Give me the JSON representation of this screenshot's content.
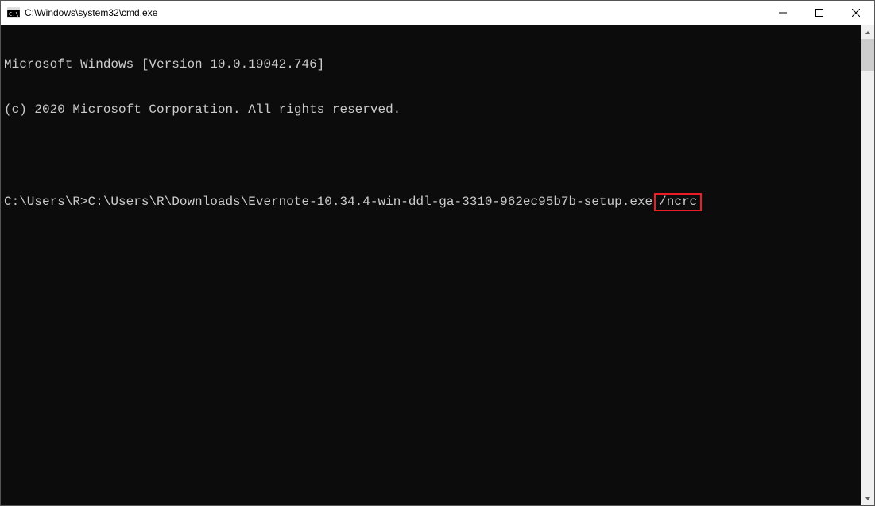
{
  "titlebar": {
    "title": "C:\\Windows\\system32\\cmd.exe"
  },
  "terminal": {
    "line1": "Microsoft Windows [Version 10.0.19042.746]",
    "line2": "(c) 2020 Microsoft Corporation. All rights reserved.",
    "line3_prompt": "C:\\Users\\R>",
    "line3_command": "C:\\Users\\R\\Downloads\\Evernote-10.34.4-win-ddl-ga-3310-962ec95b7b-setup.exe",
    "line3_flag": "/ncrc"
  }
}
